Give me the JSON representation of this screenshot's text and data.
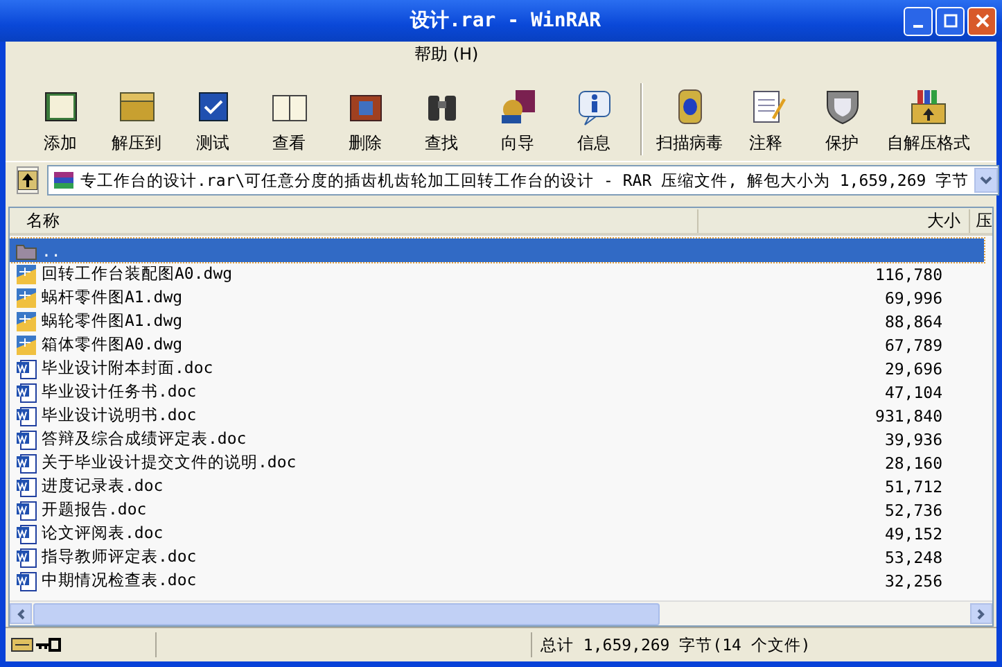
{
  "window": {
    "title": "设计.rar - WinRAR"
  },
  "menu": [
    {
      "label": "帮助 (H)"
    }
  ],
  "toolbar": [
    {
      "label": "添加"
    },
    {
      "label": "解压到"
    },
    {
      "label": "测试"
    },
    {
      "label": "查看"
    },
    {
      "label": "删除"
    },
    {
      "label": "查找"
    },
    {
      "label": "向导"
    },
    {
      "label": "信息"
    },
    {
      "label": "扫描病毒",
      "separator_before": true
    },
    {
      "label": "注释"
    },
    {
      "label": "保护"
    },
    {
      "label": "自解压格式"
    }
  ],
  "address": {
    "value": "专工作台的设计.rar\\可任意分度的插齿机齿轮加工回转工作台的设计 - RAR 压缩文件, 解包大小为 1,659,269 字节"
  },
  "table": {
    "columns": [
      "名称",
      "大小",
      "压"
    ],
    "rows": [
      {
        "kind": "parent",
        "name": "..",
        "size": "",
        "selected": true
      },
      {
        "kind": "dwg",
        "name": "回转工作台装配图A0.dwg",
        "size": "116,780",
        "selected": false
      },
      {
        "kind": "dwg",
        "name": "蜗杆零件图A1.dwg",
        "size": "69,996",
        "selected": false
      },
      {
        "kind": "dwg",
        "name": "蜗轮零件图A1.dwg",
        "size": "88,864",
        "selected": false
      },
      {
        "kind": "dwg",
        "name": "箱体零件图A0.dwg",
        "size": "67,789",
        "selected": false
      },
      {
        "kind": "doc",
        "name": "毕业设计附本封面.doc",
        "size": "29,696",
        "selected": false
      },
      {
        "kind": "doc",
        "name": "毕业设计任务书.doc",
        "size": "47,104",
        "selected": false
      },
      {
        "kind": "doc",
        "name": "毕业设计说明书.doc",
        "size": "931,840",
        "selected": false
      },
      {
        "kind": "doc",
        "name": "答辩及综合成绩评定表.doc",
        "size": "39,936",
        "selected": false
      },
      {
        "kind": "doc",
        "name": "关于毕业设计提交文件的说明.doc",
        "size": "28,160",
        "selected": false
      },
      {
        "kind": "doc",
        "name": "进度记录表.doc",
        "size": "51,712",
        "selected": false
      },
      {
        "kind": "doc",
        "name": "开题报告.doc",
        "size": "52,736",
        "selected": false
      },
      {
        "kind": "doc",
        "name": "论文评阅表.doc",
        "size": "49,152",
        "selected": false
      },
      {
        "kind": "doc",
        "name": "指导教师评定表.doc",
        "size": "53,248",
        "selected": false
      },
      {
        "kind": "doc",
        "name": "中期情况检查表.doc",
        "size": "32,256",
        "selected": false
      }
    ]
  },
  "status_bar": {
    "text": "总计 1,659,269 字节(14 个文件)"
  }
}
